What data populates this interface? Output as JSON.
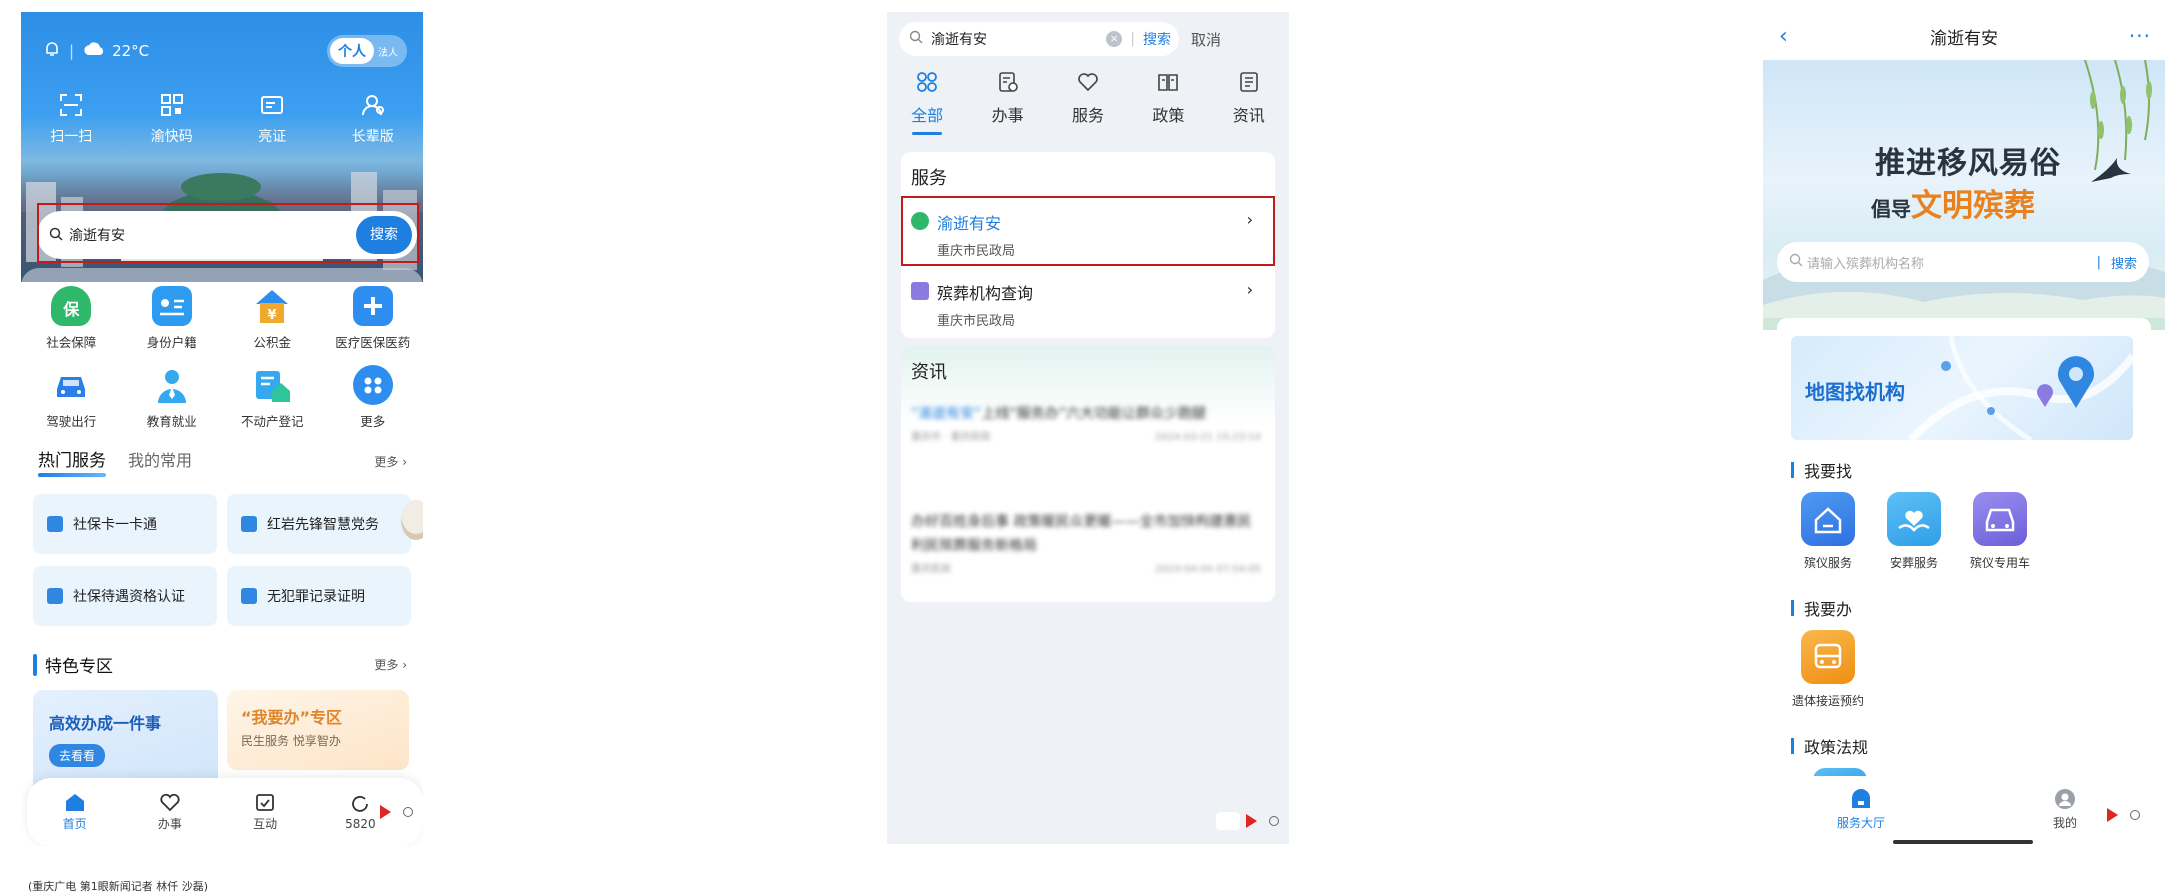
{
  "phone1": {
    "status": {
      "weather": "22°C"
    },
    "toggle": {
      "active": "个人",
      "inactive": "法人"
    },
    "quick_actions": [
      {
        "label": "扫一扫",
        "icon": "scan-icon"
      },
      {
        "label": "渝快码",
        "icon": "qr-code-icon"
      },
      {
        "label": "亮证",
        "icon": "card-icon"
      },
      {
        "label": "长辈版",
        "icon": "elder-icon"
      }
    ],
    "search": {
      "value": "渝逝有安",
      "button": "搜索"
    },
    "categories": [
      {
        "label": "社会保障",
        "icon": "social-security-icon",
        "color": "#2fb86a"
      },
      {
        "label": "身份户籍",
        "icon": "id-card-icon",
        "color": "#2d9cf0"
      },
      {
        "label": "公积金",
        "icon": "housing-fund-icon",
        "color": "#f0a92d"
      },
      {
        "label": "医疗医保医药",
        "icon": "medical-icon",
        "color": "#2d8ef0"
      },
      {
        "label": "驾驶出行",
        "icon": "car-icon",
        "color": "#2d7fe8"
      },
      {
        "label": "教育就业",
        "icon": "education-icon",
        "color": "#35a8f0"
      },
      {
        "label": "不动产登记",
        "icon": "real-estate-icon",
        "color": "#2fb8b0"
      },
      {
        "label": "更多",
        "icon": "more-icon",
        "color": "#2d8ef0"
      }
    ],
    "tabs": {
      "hot": "热门服务",
      "mine": "我的常用",
      "more": "更多 ›"
    },
    "services": [
      "社保卡一卡通",
      "红岩先锋智慧党务",
      "社保待遇资格认证",
      "无犯罪记录证明"
    ],
    "special": {
      "title": "特色专区",
      "more": "更多 ›",
      "card1_title": "高效办成一件事",
      "card1_button": "去看看",
      "card2_title": "“我要办”专区",
      "card2_sub": "民生服务 悦享智办"
    },
    "tabbar": [
      "首页",
      "办事",
      "互动",
      "5820"
    ],
    "caption": "(重庆广电 第1眼新闻记者 林仟 沙磊)"
  },
  "phone2": {
    "search": {
      "value": "渝逝有安",
      "clear": "×",
      "button": "搜索",
      "cancel": "取消"
    },
    "categories": [
      {
        "label": "全部",
        "icon": "all-icon",
        "active": true
      },
      {
        "label": "办事",
        "icon": "affairs-icon",
        "active": false
      },
      {
        "label": "服务",
        "icon": "service-heart-icon",
        "active": false
      },
      {
        "label": "政策",
        "icon": "policy-icon",
        "active": false
      },
      {
        "label": "资讯",
        "icon": "news-icon",
        "active": false
      }
    ],
    "service_section": {
      "title": "服务",
      "results": [
        {
          "title": "渝逝有安",
          "org": "重庆市民政局",
          "arrow": "›"
        },
        {
          "title": "殡葬机构查询",
          "org": "重庆市民政局",
          "arrow": "›"
        }
      ]
    },
    "news_section": {
      "title": "资讯",
      "items": [
        {
          "highlight": "“渝逝有安”",
          "text": "上线“服务办”六大功能让群众少跑腿",
          "source": "重庆市 · 重庆民政",
          "date": "2024-03-21 15:23:14"
        },
        {
          "highlight": "",
          "text": "办好百姓身后事 政策暖民众更暖——全市加快构建惠民利民殡葬服务新格局",
          "source": "重庆民政",
          "date": "2024-04-04 07:54:05"
        }
      ]
    }
  },
  "phone3": {
    "nav": {
      "back": "‹",
      "title": "渝逝有安",
      "more": "···"
    },
    "banner": {
      "line1": "推进移风易俗",
      "line2_prefix": "倡导",
      "line2_highlight": "文明殡葬"
    },
    "search": {
      "placeholder": "请输入殡葬机构名称",
      "button": "搜索"
    },
    "map_card": {
      "title": "地图找机构"
    },
    "find_section": {
      "title": "我要找",
      "items": [
        {
          "label": "殡仪服务",
          "icon": "funeral-home-icon",
          "color": "#2f7fe8"
        },
        {
          "label": "安葬服务",
          "icon": "burial-care-icon",
          "color": "#2fa8ee"
        },
        {
          "label": "殡仪专用车",
          "icon": "hearse-icon",
          "color": "#7a6de0"
        }
      ]
    },
    "do_section": {
      "title": "我要办",
      "items": [
        {
          "label": "遗体接运预约",
          "icon": "transport-booking-icon",
          "color": "#f3a21f"
        }
      ]
    },
    "policy_section": {
      "title": "政策法规"
    },
    "tabbar": {
      "left": "服务大厅",
      "right": "我的"
    }
  },
  "colors": {
    "accent": "#1f7fe0",
    "highlight_box": "#c01c1c",
    "orange": "#e9821e"
  }
}
